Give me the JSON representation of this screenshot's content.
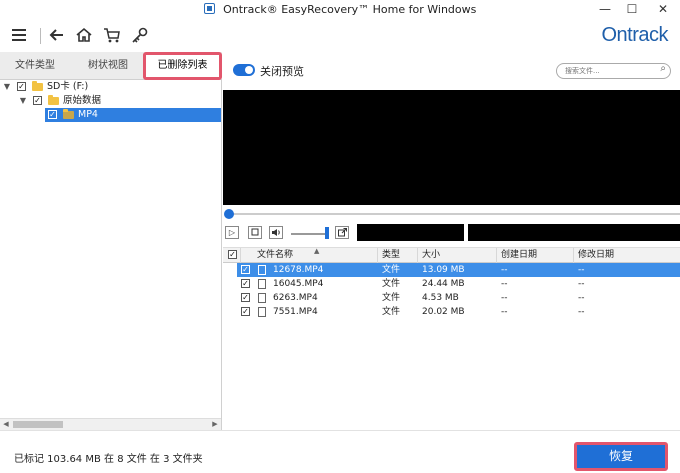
{
  "window": {
    "title": "Ontrack® EasyRecovery™ Home for Windows",
    "controls": [
      "—",
      "☐",
      "✕"
    ]
  },
  "toolbar": {
    "icons": [
      "menu-icon",
      "back-icon",
      "home-icon",
      "cart-icon",
      "key-icon"
    ],
    "brand": "Ontrack"
  },
  "left": {
    "tabs": [
      {
        "label": "文件类型",
        "active": false
      },
      {
        "label": "树状视图",
        "active": false
      },
      {
        "label": "已删除列表",
        "active": true
      }
    ],
    "tree": [
      {
        "label": "SD卡 (F:)",
        "level": 0,
        "expanded": true,
        "checked": true,
        "selected": false
      },
      {
        "label": "原始数据",
        "level": 1,
        "expanded": true,
        "checked": true,
        "selected": false
      },
      {
        "label": "MP4",
        "level": 2,
        "expanded": false,
        "checked": true,
        "selected": true
      }
    ]
  },
  "preview": {
    "toggle_label": "关闭预览",
    "toggle_on": true,
    "search_placeholder": "搜索文件..."
  },
  "player": {
    "buttons": [
      "play-icon",
      "stop-icon",
      "volume-icon",
      "popout-icon"
    ]
  },
  "table": {
    "columns": [
      "文件名称",
      "类型",
      "大小",
      "创建日期",
      "修改日期"
    ],
    "rows": [
      {
        "name": "12678.MP4",
        "type": "文件",
        "size": "13.09 MB",
        "created": "--",
        "modified": "--",
        "checked": true,
        "selected": true
      },
      {
        "name": "16045.MP4",
        "type": "文件",
        "size": "24.44 MB",
        "created": "--",
        "modified": "--",
        "checked": true,
        "selected": false
      },
      {
        "name": "6263.MP4",
        "type": "文件",
        "size": "4.53 MB",
        "created": "--",
        "modified": "--",
        "checked": true,
        "selected": false
      },
      {
        "name": "7551.MP4",
        "type": "文件",
        "size": "20.02 MB",
        "created": "--",
        "modified": "--",
        "checked": true,
        "selected": false
      }
    ]
  },
  "footer": {
    "status": "已标记 103.64 MB 在 8 文件 在 3 文件夹",
    "restore_label": "恢复"
  },
  "colors": {
    "accent": "#1f6fd6",
    "highlight_border": "#e2566c",
    "selection": "#3d8ee8"
  }
}
